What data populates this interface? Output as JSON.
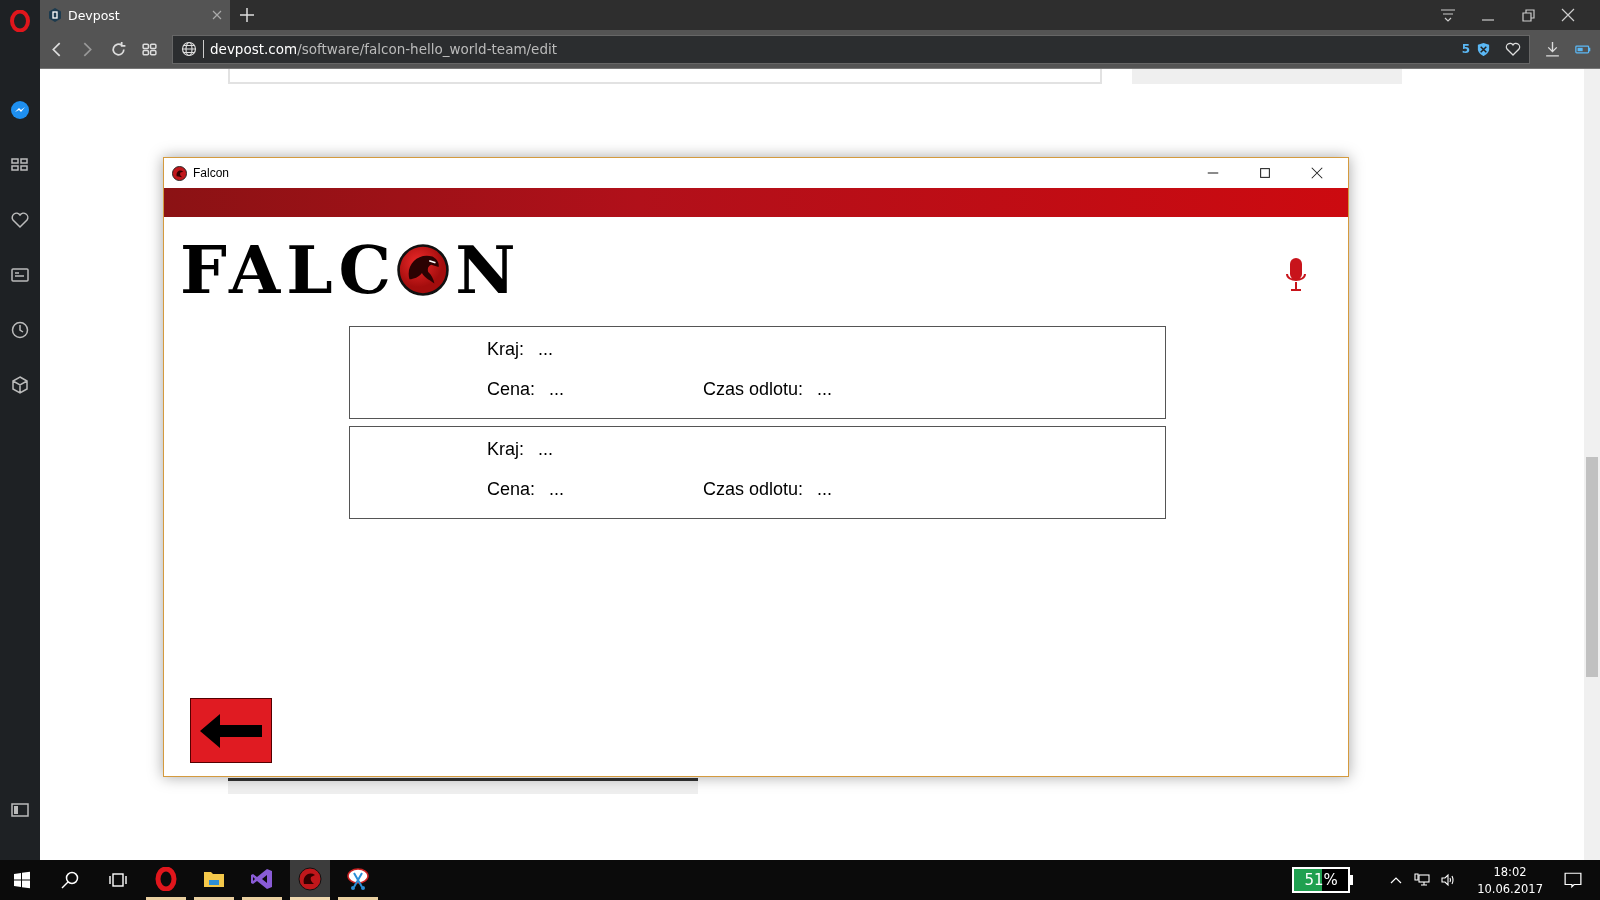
{
  "browser": {
    "tab": {
      "title": "Devpost"
    },
    "url": {
      "host": "devpost.com",
      "path": "/software/falcon-hello_world-team/edit"
    },
    "blocked_count": "5"
  },
  "app_window": {
    "title": "Falcon",
    "logo": {
      "left": "FALC",
      "right": "N"
    },
    "results": [
      {
        "country_label": "Kraj:",
        "country": "...",
        "price_label": "Cena:",
        "price": "...",
        "departure_label": "Czas odlotu:",
        "departure": "..."
      },
      {
        "country_label": "Kraj:",
        "country": "...",
        "price_label": "Cena:",
        "price": "...",
        "departure_label": "Czas odlotu:",
        "departure": "..."
      }
    ]
  },
  "taskbar": {
    "apps": [
      {
        "kind": "opera",
        "active": false
      },
      {
        "kind": "folder",
        "active": false
      },
      {
        "kind": "studio",
        "active": false
      },
      {
        "kind": "falcon",
        "active": true
      },
      {
        "kind": "snip",
        "active": false
      }
    ],
    "battery": {
      "level": 0.51,
      "reading": "51%"
    },
    "time": "18:02",
    "date": "10.06.2017"
  }
}
